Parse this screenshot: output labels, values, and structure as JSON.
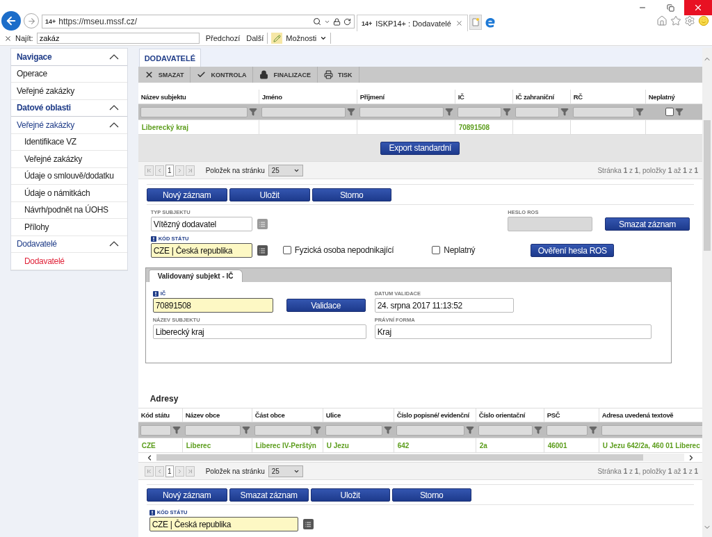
{
  "browser": {
    "address": {
      "favicon": "14+",
      "url": "https://mseu.mssf.cz/"
    },
    "tab": {
      "favicon": "14+",
      "title": "ISKP14+ : Dodavatelé"
    }
  },
  "find_bar": {
    "label": "Najít:",
    "value": "zakáz",
    "previous": "Předchozí",
    "next": "Další",
    "options": "Možnosti"
  },
  "sidebar": [
    {
      "kind": "header",
      "label": "Navigace",
      "expanded": true
    },
    {
      "kind": "link",
      "label": "Operace",
      "selected": false
    },
    {
      "kind": "link",
      "label": "Veřejné zakázky",
      "selected": false
    },
    {
      "kind": "header",
      "label": "Datové oblasti",
      "expanded": true
    },
    {
      "kind": "group",
      "label": "Veřejné zakázky",
      "expanded": true
    },
    {
      "kind": "sub",
      "label": "Identifikace VZ",
      "selected": false
    },
    {
      "kind": "sub",
      "label": "Veřejné zakázky",
      "selected": false
    },
    {
      "kind": "sub",
      "label": "Údaje o smlouvě/dodatku",
      "selected": false
    },
    {
      "kind": "sub",
      "label": "Údaje o námitkách",
      "selected": false
    },
    {
      "kind": "sub",
      "label": "Návrh/podnět na ÚOHS",
      "selected": false
    },
    {
      "kind": "sub",
      "label": "Přílohy",
      "selected": false
    },
    {
      "kind": "group",
      "label": "Dodavatelé",
      "expanded": true
    },
    {
      "kind": "sub",
      "label": "Dodavatelé",
      "selected": true
    }
  ],
  "page_tabs": [
    {
      "label": "DODAVATELÉ",
      "selected": true
    }
  ],
  "toolbar": [
    {
      "kind": "delete",
      "label": "SMAZAT"
    },
    {
      "kind": "check",
      "label": "KONTROLA"
    },
    {
      "kind": "lock",
      "label": "FINALIZACE"
    },
    {
      "kind": "print",
      "label": "TISK"
    }
  ],
  "suppliers": {
    "columns": [
      {
        "label": "Název subjektu",
        "kind": "text"
      },
      {
        "label": "Jméno",
        "kind": "text"
      },
      {
        "label": "Příjmení",
        "kind": "text"
      },
      {
        "label": "IČ",
        "kind": "text"
      },
      {
        "label": "IČ zahraniční",
        "kind": "text"
      },
      {
        "label": "RČ",
        "kind": "text"
      },
      {
        "label": "Neplatný",
        "kind": "checkbox",
        "checked": false
      }
    ],
    "rows": [
      [
        "Liberecký kraj",
        null,
        null,
        "70891508",
        null,
        null,
        null
      ]
    ],
    "export": "Export standardní",
    "pager": {
      "page": "1",
      "per_page_label": "Položek na stránku",
      "per_page": "25",
      "summary": "Stránka **1** z **1**, položky **1** až **1** z **1**"
    }
  },
  "form": {
    "buttons": [
      "Nový záznam",
      "Uložit",
      "Storno"
    ],
    "typ_subjektu": {
      "label": "TYP SUBJEKTU",
      "value": "Vítězný dodavatel",
      "required": false
    },
    "heslo_ros": {
      "label": "HESLO ROS",
      "disabled": true
    },
    "delete_button": "Smazat záznam",
    "kod_statu": {
      "label": "KÓD STÁTU",
      "value": "CZE | Česká republika",
      "required": true
    },
    "checkboxes": [
      {
        "label": "Fyzická osoba nepodnikající",
        "checked": false
      },
      {
        "label": "Neplatný",
        "checked": false
      }
    ],
    "verify_button": "Ověření hesla ROS"
  },
  "validation": {
    "tabs": [
      {
        "label": "Validovaný subjekt - IČ",
        "selected": true
      }
    ],
    "ic": {
      "label": "IČ",
      "value": "70891508",
      "required": true
    },
    "validate_button": "Validace",
    "datum": {
      "label": "DATUM VALIDACE",
      "value": "24. srpna 2017 11:13:52",
      "required": false
    },
    "nazev": {
      "label": "NÁZEV SUBJEKTU",
      "value": "Liberecký kraj",
      "required": false
    },
    "pravni_forma": {
      "label": "PRÁVNÍ FORMA",
      "value": "Kraj",
      "required": false
    }
  },
  "addresses": {
    "title": "Adresy",
    "columns": [
      "Kód státu",
      "Název obce",
      "Část obce",
      "Ulice",
      "Číslo popisné/ evidenční",
      "Číslo orientační",
      "PSČ",
      "Adresa uvedená textově"
    ],
    "rows": [
      [
        "CZE",
        "Liberec",
        "Liberec IV-Perštýn",
        "U Jezu",
        "642",
        "2a",
        "46001",
        "U Jezu 642/2a, 460 01 Liberec"
      ]
    ],
    "pager": {
      "page": "1",
      "per_page_label": "Položek na stránku",
      "per_page": "25",
      "summary": "Stránka **1** z **1**, položky **1** až **1** z **1**"
    },
    "buttons": [
      "Nový záznam",
      "Smazat záznam",
      "Uložit",
      "Storno"
    ],
    "kod_statu": {
      "label": "KÓD STÁTU",
      "value": "CZE | Česká republika",
      "required": true
    }
  }
}
